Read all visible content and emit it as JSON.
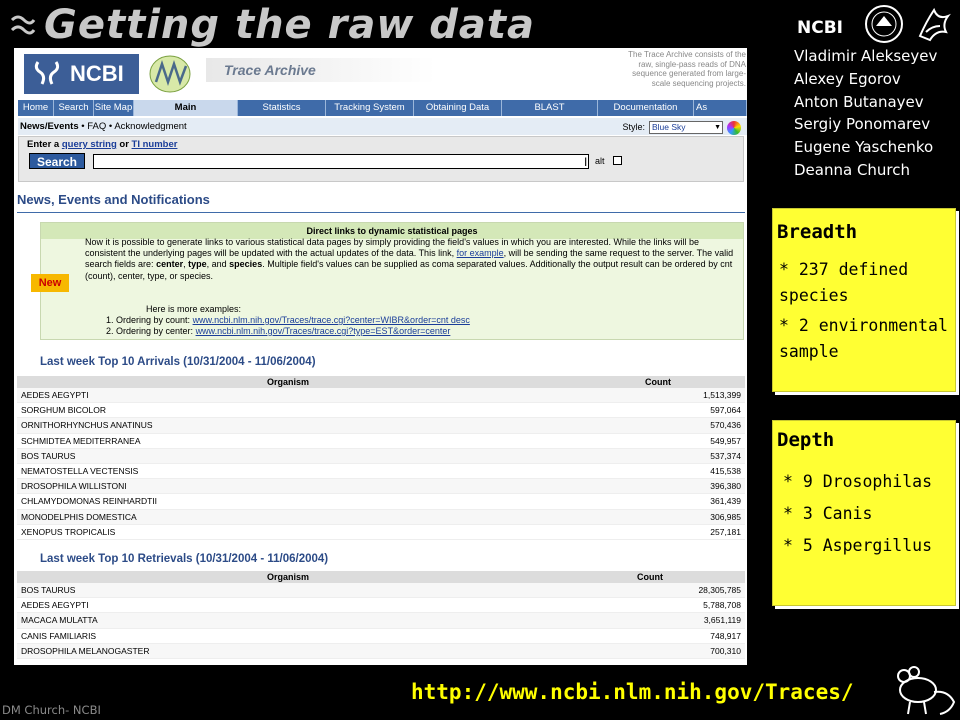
{
  "slide": {
    "title": "Getting the raw data",
    "ncbi_label": "NCBI",
    "authors": [
      "Vladimir Alekseyev",
      "Alexey Egorov",
      "Anton Butanayev",
      "Sergiy Ponomarev",
      "Eugene Yaschenko",
      "Deanna Church"
    ],
    "url": "http://www.ncbi.nlm.nih.gov/Traces/",
    "footer": "DM Church- NCBI"
  },
  "page": {
    "logo_text": "NCBI",
    "site_title": "Trace Archive",
    "blurb": "The Trace Archive consists of the raw, single-pass reads of DNA sequence generated from large-scale sequencing projects.",
    "nav": [
      {
        "label": "Home"
      },
      {
        "label": "Search"
      },
      {
        "label": "Site Map"
      },
      {
        "label": "Main"
      },
      {
        "label": "Statistics"
      },
      {
        "label": "Tracking System"
      },
      {
        "label": "Obtaining Data"
      },
      {
        "label": "BLAST"
      },
      {
        "label": "Documentation"
      },
      {
        "label": "As"
      }
    ],
    "subnav": {
      "news": "News/Events",
      "faq": "FAQ",
      "ack": "Acknowledgment",
      "style_label": "Style:",
      "style_value": "Blue Sky"
    },
    "search": {
      "label_prefix": "Enter a",
      "label_link1": "query string",
      "label_mid": "or",
      "label_link2": "TI number",
      "button": "Search",
      "value": "",
      "alt_label": "alt"
    },
    "news_heading": "News, Events and Notifications",
    "news_box": {
      "header": "Direct links to dynamic statistical pages",
      "badge": "New",
      "body_1": "Now it is possible to generate links to various statistical data pages by simply providing the field's values in which you are interested. While the links will be consistent the underlying pages will be updated with the actual updates of the data. This link,",
      "body_link": "for example",
      "body_2": ", will be sending the same request to the server. The valid search fields are:",
      "body_fields_1": "center",
      "body_sep_1": ",",
      "body_fields_2": "type",
      "body_sep_2": ", and",
      "body_fields_3": "species",
      "body_3": ". Multiple field's values can be supplied as coma separated values. Additionally the output result can be ordered by cnt (count), center, type, or species.",
      "examples_intro": "Here is more examples:",
      "example_1_label": "1.  Ordering by count:",
      "example_1_link": "www.ncbi.nlm.nih.gov/Traces/trace.cgi?center=WIBR&order=cnt desc",
      "example_2_label": "2.  Ordering by center:",
      "example_2_link": "www.ncbi.nlm.nih.gov/Traces/trace.cgi?type=EST&order=center"
    },
    "arrivals": {
      "title": "Last week Top 10 Arrivals (10/31/2004 - 11/06/2004)",
      "col_organism": "Organism",
      "col_count": "Count",
      "rows": [
        {
          "organism": "AEDES AEGYPTI",
          "count": "1,513,399"
        },
        {
          "organism": "SORGHUM BICOLOR",
          "count": "597,064"
        },
        {
          "organism": "ORNITHORHYNCHUS ANATINUS",
          "count": "570,436"
        },
        {
          "organism": "SCHMIDTEA MEDITERRANEA",
          "count": "549,957"
        },
        {
          "organism": "BOS TAURUS",
          "count": "537,374"
        },
        {
          "organism": "NEMATOSTELLA VECTENSIS",
          "count": "415,538"
        },
        {
          "organism": "DROSOPHILA WILLISTONI",
          "count": "396,380"
        },
        {
          "organism": "CHLAMYDOMONAS REINHARDTII",
          "count": "361,439"
        },
        {
          "organism": "MONODELPHIS DOMESTICA",
          "count": "306,985"
        },
        {
          "organism": "XENOPUS TROPICALIS",
          "count": "257,181"
        }
      ]
    },
    "retrievals": {
      "title": "Last week Top 10 Retrievals (10/31/2004 - 11/06/2004)",
      "col_organism": "Organism",
      "col_count": "Count",
      "rows": [
        {
          "organism": "BOS TAURUS",
          "count": "28,305,785"
        },
        {
          "organism": "AEDES AEGYPTI",
          "count": "5,788,708"
        },
        {
          "organism": "MACACA MULATTA",
          "count": "3,651,119"
        },
        {
          "organism": "CANIS FAMILIARIS",
          "count": "748,917"
        },
        {
          "organism": "DROSOPHILA MELANOGASTER",
          "count": "700,310"
        }
      ]
    }
  },
  "breadth": {
    "title": "Breadth",
    "item_1a": "* 237 defined",
    "item_1b": "species",
    "item_2a": "* 2 environmental",
    "item_2b": "sample"
  },
  "depth": {
    "title": "Depth",
    "item_1": "* 9 Drosophilas",
    "item_2": "* 3 Canis",
    "item_3": "* 5 Aspergillus"
  },
  "colors": {
    "background": "#000000",
    "callout": "#ffff33",
    "url": "#ffff00",
    "ncbi_blue": "#3f6ba9"
  }
}
